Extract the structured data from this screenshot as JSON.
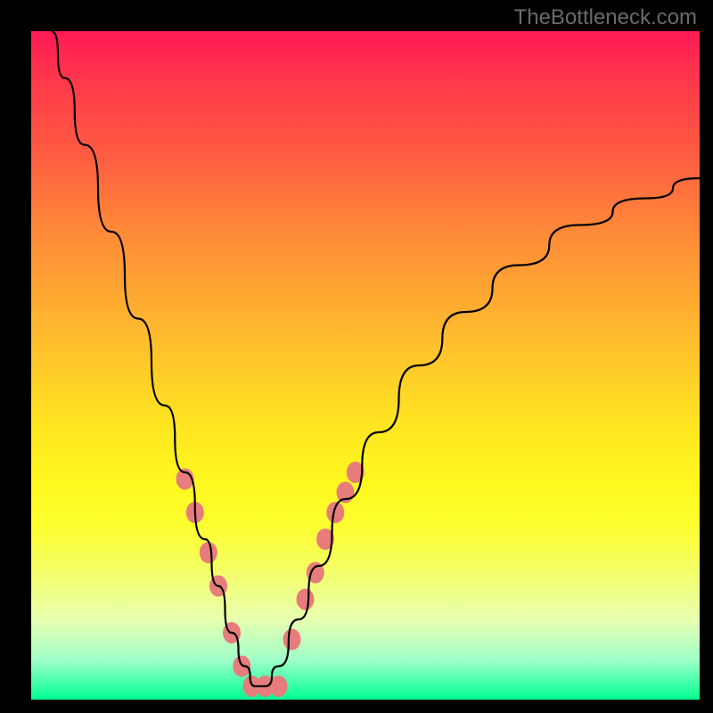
{
  "watermark": "TheBottleneck.com",
  "chart_data": {
    "type": "line",
    "title": "",
    "xlabel": "",
    "ylabel": "",
    "xlim": [
      0,
      100
    ],
    "ylim": [
      0,
      100
    ],
    "gradient": {
      "direction": "vertical",
      "stops": [
        {
          "pos": 0,
          "color": "#ff1a55"
        },
        {
          "pos": 0.18,
          "color": "#ff5a42"
        },
        {
          "pos": 0.42,
          "color": "#ffb030"
        },
        {
          "pos": 0.6,
          "color": "#ffe820"
        },
        {
          "pos": 0.8,
          "color": "#f5ff60"
        },
        {
          "pos": 0.94,
          "color": "#a0ffc8"
        },
        {
          "pos": 1.0,
          "color": "#00ff90"
        }
      ]
    },
    "series": [
      {
        "name": "bottleneck-curve",
        "color": "#000000",
        "x": [
          3,
          5,
          8,
          12,
          16,
          20,
          23,
          26,
          28,
          30,
          32,
          33.5,
          35,
          37,
          40,
          43,
          47,
          52,
          58,
          65,
          73,
          82,
          92,
          100
        ],
        "y": [
          100,
          93,
          83,
          70,
          57,
          44,
          34,
          24,
          17,
          10,
          5,
          2,
          2,
          5,
          12,
          20,
          30,
          40,
          50,
          58,
          65,
          71,
          75,
          78
        ]
      }
    ],
    "markers": {
      "color": "#e67c7c",
      "radius": 10,
      "points": [
        {
          "x": 23,
          "y": 33
        },
        {
          "x": 24.5,
          "y": 28
        },
        {
          "x": 26.5,
          "y": 22
        },
        {
          "x": 28,
          "y": 17
        },
        {
          "x": 30,
          "y": 10
        },
        {
          "x": 31.5,
          "y": 5
        },
        {
          "x": 33,
          "y": 2
        },
        {
          "x": 35,
          "y": 2
        },
        {
          "x": 37,
          "y": 2
        },
        {
          "x": 39,
          "y": 9
        },
        {
          "x": 41,
          "y": 15
        },
        {
          "x": 42.5,
          "y": 19
        },
        {
          "x": 44,
          "y": 24
        },
        {
          "x": 45.5,
          "y": 28
        },
        {
          "x": 47,
          "y": 31
        },
        {
          "x": 48.5,
          "y": 34
        }
      ]
    }
  }
}
